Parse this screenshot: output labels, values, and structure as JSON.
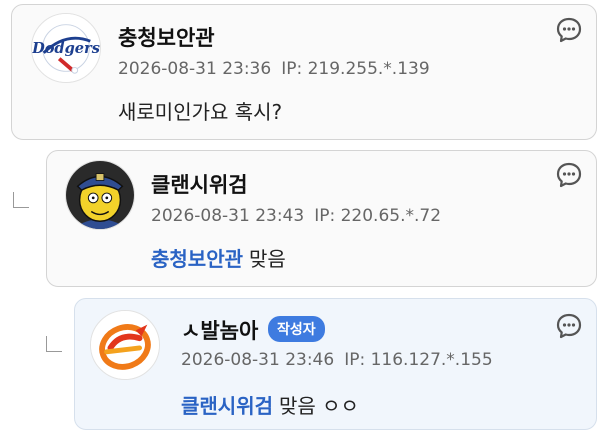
{
  "comments": [
    {
      "nickname": "충청보안관",
      "date": "2026-08-31 23:36",
      "ip": "IP: 219.255.*.139",
      "text": "새로미인가요 혹시?",
      "avatar": "dodgers-logo",
      "more_icon": "comment-more-icon"
    },
    {
      "nickname": "클랜시위검",
      "date": "2026-08-31 23:43",
      "ip": "IP: 220.65.*.72",
      "mention": "충청보안관",
      "text": "맞음",
      "avatar": "chief-wiggum-cartoon",
      "more_icon": "comment-more-icon"
    },
    {
      "nickname": "ㅅ발놈아",
      "author_badge": "작성자",
      "date": "2026-08-31 23:46",
      "ip": "IP: 116.127.*.155",
      "mention": "클랜시위검",
      "text": "맞음 ㅇㅇ",
      "avatar": "orange-e-logo",
      "more_icon": "comment-more-icon"
    }
  ],
  "colors": {
    "mention": "#2a63c4",
    "badge": "#3e7be0",
    "author_card_bg": "#f1f6fc"
  }
}
